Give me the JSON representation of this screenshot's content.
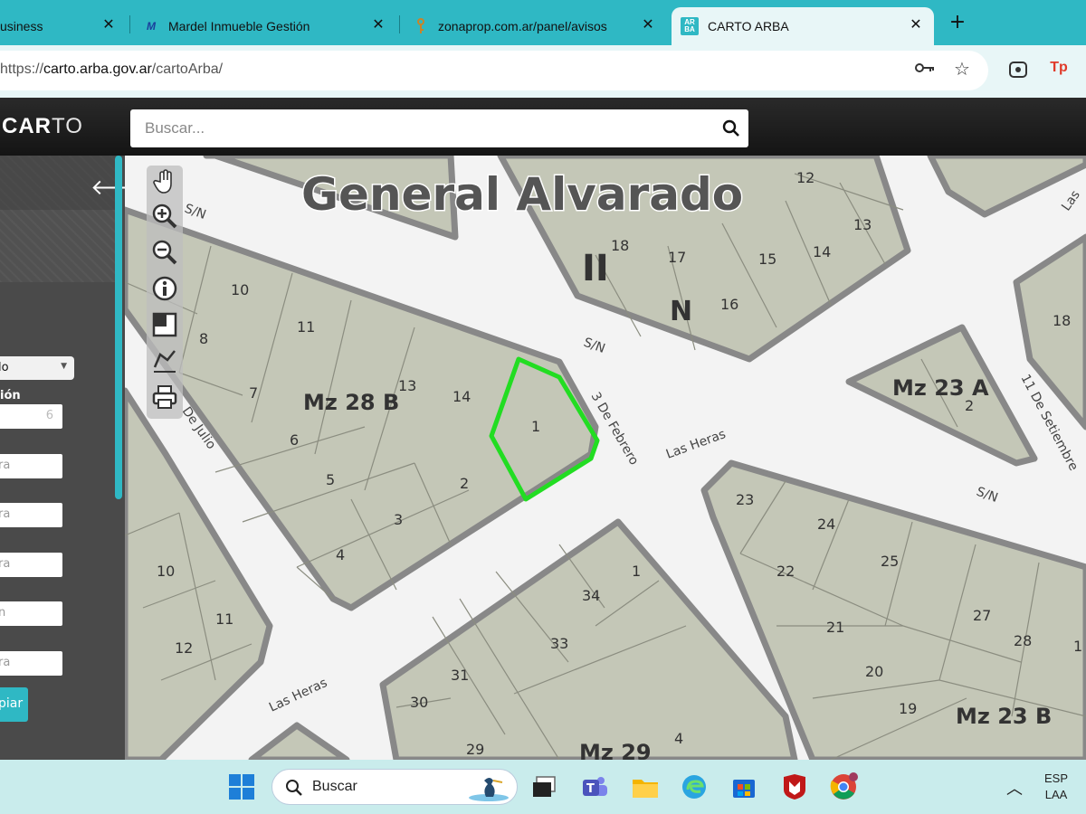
{
  "browser": {
    "tabs": [
      {
        "label": "usiness",
        "favicon": "business-icon"
      },
      {
        "label": "Mardel Inmueble Gestión",
        "favicon": "mi-logo-icon"
      },
      {
        "label": "zonaprop.com.ar/panel/avisos",
        "favicon": "key-icon"
      },
      {
        "label": "CARTO ARBA",
        "favicon": "arba-logo-icon"
      }
    ],
    "close_glyph": "✕",
    "new_tab_glyph": "+",
    "url": {
      "scheme": "https://",
      "host": "carto.arba.gov.ar",
      "path": "/cartoArba/"
    },
    "ext_badge": "Tp"
  },
  "app": {
    "logo_left": "CAR",
    "logo_right": "TO",
    "search_placeholder": "Buscar..."
  },
  "sidepanel": {
    "select_value": "lo",
    "section_label": "ión",
    "inputs": [
      "6",
      "ra",
      "ra",
      "ra",
      "n",
      "ra"
    ],
    "copy_button": "piar"
  },
  "map": {
    "city": "General Alvarado",
    "section_numeral": "II",
    "section_letter": "N",
    "blocks": [
      "Mz 28 B",
      "Mz 23 A",
      "Mz 23 B",
      "Mz 29"
    ],
    "streets": [
      "S/N",
      "S/N",
      "3 De Febrero",
      "Las Heras",
      "S/N",
      "Las Heras",
      "De Julio",
      "11 De Setiembre",
      "Las"
    ],
    "lots_top": [
      "12",
      "13",
      "14",
      "15",
      "16",
      "17",
      "18",
      "18"
    ],
    "lots_28b": [
      "10",
      "11",
      "8",
      "7",
      "13",
      "14",
      "1",
      "6",
      "5",
      "2",
      "3",
      "4"
    ],
    "lots_23a": [
      "2"
    ],
    "lots_left": [
      "10",
      "11",
      "12"
    ],
    "lots_29": [
      "1",
      "34",
      "33",
      "31",
      "30",
      "29",
      "4"
    ],
    "lots_23b": [
      "23",
      "24",
      "25",
      "22",
      "21",
      "20",
      "27",
      "28",
      "19",
      "1"
    ],
    "selected_lot": "1",
    "selection_color": "#22dd22"
  },
  "taskbar": {
    "search_label": "Buscar",
    "lang_line1": "ESP",
    "lang_line2": "LAA"
  }
}
